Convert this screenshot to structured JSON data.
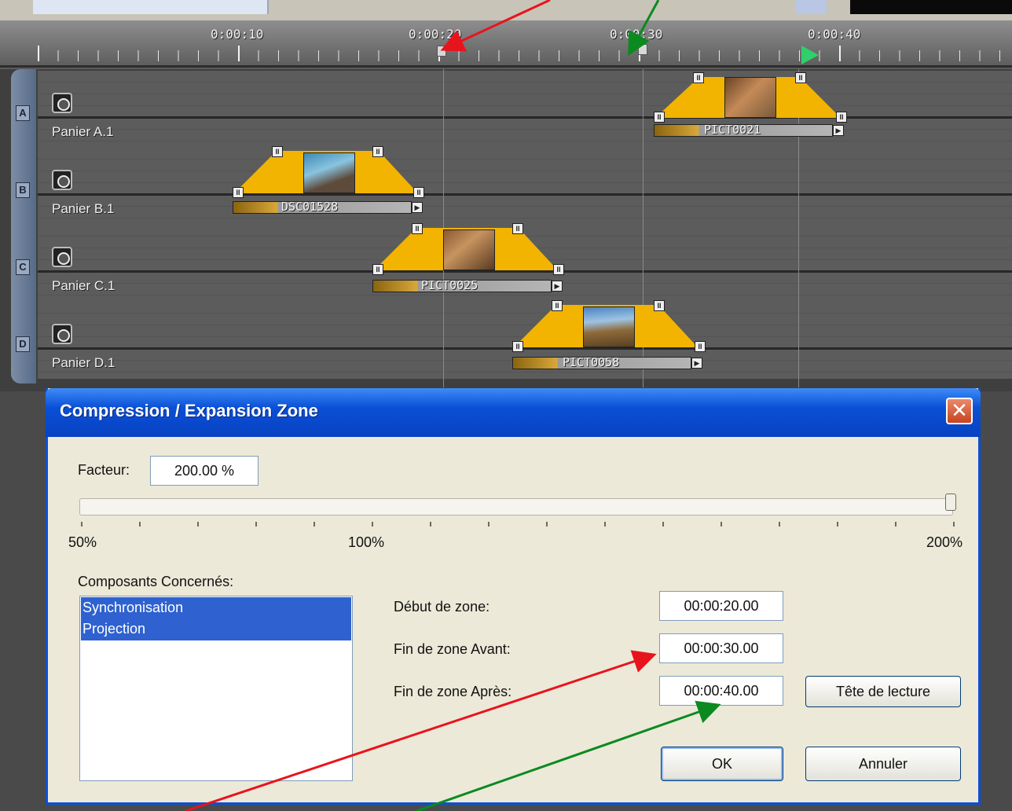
{
  "ruler": {
    "labels": [
      "0:00:10",
      "0:00:20",
      "0:00:30",
      "0:00:40"
    ]
  },
  "tracks": [
    {
      "letter": "A",
      "name": "Panier A.1"
    },
    {
      "letter": "B",
      "name": "Panier B.1"
    },
    {
      "letter": "C",
      "name": "Panier C.1"
    },
    {
      "letter": "D",
      "name": "Panier D.1"
    }
  ],
  "clips": [
    {
      "name": "PICT0021"
    },
    {
      "name": "DSC01528"
    },
    {
      "name": "PICT0025"
    },
    {
      "name": "PICT0058"
    }
  ],
  "dialog": {
    "title": "Compression / Expansion Zone",
    "close_symbol": "✕",
    "factor_label": "Facteur:",
    "factor_value": "200.00 %",
    "slider_labels": [
      "50%",
      "100%",
      "200%"
    ],
    "slider_level_percent": 200,
    "components_label": "Composants Concernés:",
    "components": [
      "Synchronisation",
      "Projection"
    ],
    "zone_start_label": "Début de zone:",
    "zone_start_value": "00:00:20.00",
    "zone_end_before_label": "Fin de zone Avant:",
    "zone_end_before_value": "00:00:30.00",
    "zone_end_after_label": "Fin de zone Après:",
    "zone_end_after_value": "00:00:40.00",
    "playhead_button": "Tête de lecture",
    "ok_button": "OK",
    "cancel_button": "Annuler"
  },
  "colors": {
    "title_bar": "#0a4fd6",
    "close": "#c8431f",
    "clip_envelope": "#f2b400",
    "playhead": "#2fd06a",
    "arrow_red": "#e8141c",
    "arrow_green": "#0b8a1f"
  }
}
